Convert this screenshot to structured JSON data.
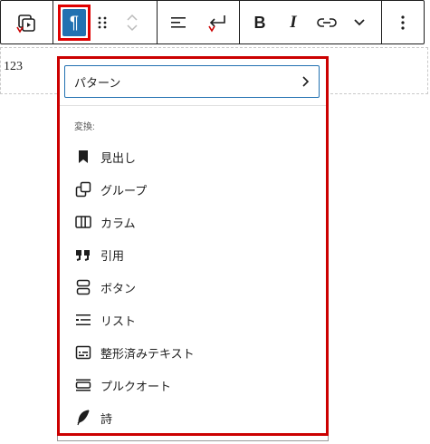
{
  "toolbar": {
    "paragraph_symbol": "¶",
    "bold": "B",
    "italic": "I"
  },
  "block": {
    "text": "123"
  },
  "popover": {
    "patterns_label": "パターン",
    "section_label": "変換:",
    "items": [
      {
        "label": "見出し",
        "icon": "bookmark-icon"
      },
      {
        "label": "グループ",
        "icon": "group-icon"
      },
      {
        "label": "カラム",
        "icon": "columns-icon"
      },
      {
        "label": "引用",
        "icon": "quote-icon"
      },
      {
        "label": "ボタン",
        "icon": "buttons-icon"
      },
      {
        "label": "リスト",
        "icon": "list-icon"
      },
      {
        "label": "整形済みテキスト",
        "icon": "preformatted-icon"
      },
      {
        "label": "プルクオート",
        "icon": "pullquote-icon"
      },
      {
        "label": "詩",
        "icon": "verse-icon"
      }
    ]
  },
  "colors": {
    "accent": "#2271b1",
    "highlight_border": "#cc0000"
  }
}
